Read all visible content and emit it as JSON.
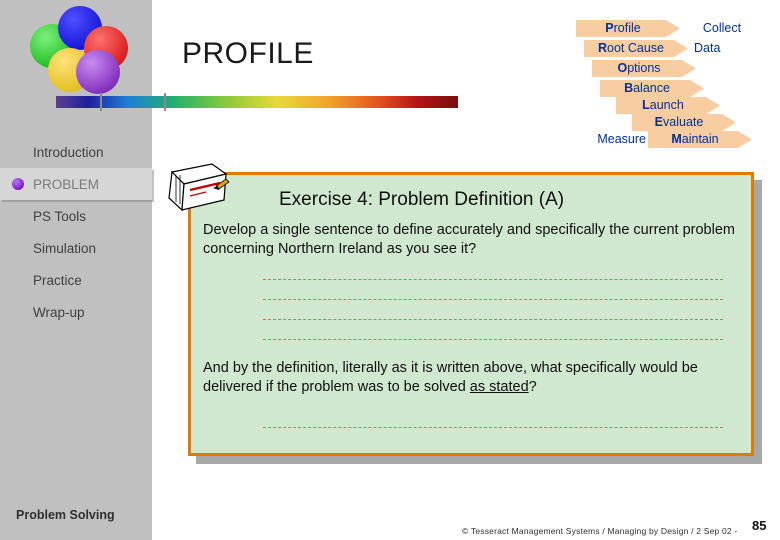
{
  "slide": {
    "title": "PROFILE",
    "page_number": "85",
    "footer": "© Tesseract Management Systems / Managing by Design / 2 Sep 02  -"
  },
  "logo": {
    "name": "five-circle-logo",
    "circle_colors": [
      "#0000cc",
      "#00a800",
      "#cc0000",
      "#d8b400",
      "#6a0dad"
    ]
  },
  "rainbow_bar": {
    "name": "rainbow-gradient-bar"
  },
  "process_diagram": {
    "name": "profile-process-chevrons",
    "steps": [
      {
        "initial": "P",
        "rest": "rofile"
      },
      {
        "initial": "R",
        "rest": "oot Cause"
      },
      {
        "initial": "O",
        "rest": "ptions"
      },
      {
        "initial": "B",
        "rest": "alance"
      },
      {
        "initial": "L",
        "rest": "aunch"
      },
      {
        "initial": "E",
        "rest": "valuate"
      },
      {
        "initial": "M",
        "rest": "aintain"
      }
    ],
    "labels": {
      "collect": "Collect",
      "data": "Data",
      "measure": "Measure"
    }
  },
  "sidebar": {
    "footer_label": "Problem Solving",
    "items": [
      {
        "label": "Introduction",
        "active": false
      },
      {
        "label": "PROBLEM",
        "active": true
      },
      {
        "label": "PS Tools",
        "active": false
      },
      {
        "label": "Simulation",
        "active": false
      },
      {
        "label": "Practice",
        "active": false
      },
      {
        "label": "Wrap-up",
        "active": false
      }
    ]
  },
  "exercise": {
    "heading": "Exercise 4: Problem Definition (A)",
    "paragraph1": "Develop a single sentence to define accurately and specifically the current problem concerning Northern Ireland as you see it?",
    "paragraph2_pre": "And by the definition, literally as it is written above, what specifically would be delivered if the problem was to be solved ",
    "paragraph2_underlined": "as stated",
    "paragraph2_post": "?",
    "answer_lines": 5
  },
  "colors": {
    "card_background": "#cfe8cf",
    "card_border": "#e07a00",
    "sidebar": "#c0c0c0",
    "chevron_fill": "#f7cda1",
    "chevron_text": "#0030a0",
    "rule": "#f06060"
  }
}
